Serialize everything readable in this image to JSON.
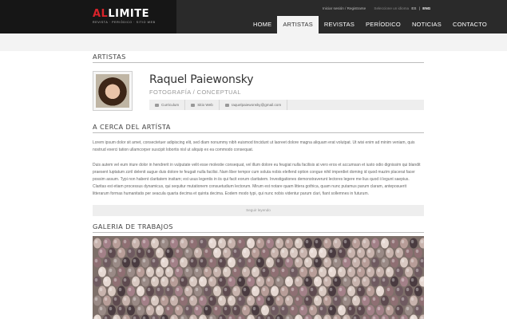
{
  "logo": {
    "brand_prefix": "AL",
    "brand_main": "LIMITE",
    "tagline": "REVISTA · PERIÓDICO · SITIO WEB"
  },
  "top_links": {
    "login": "Iniciar sesión / Registrarse",
    "language_label": "Seleccione un idioma",
    "lang_es": "ES",
    "lang_sep": "|",
    "lang_en": "ENG"
  },
  "nav": {
    "items": [
      "HOME",
      "ARTISTAS",
      "REVISTAS",
      "PERÍODICO",
      "NOTICIAS",
      "CONTACTO"
    ]
  },
  "section": {
    "artists": "ARTISTAS",
    "about": "A CERCA DEL ARTÍSTA",
    "gallery": "GALERIA DE TRABAJOS"
  },
  "artist": {
    "name": "Raquel Paiewonsky",
    "category": "FOTOGRAFÍA / CONCEPTUAL",
    "links": {
      "cv": "Curriculum",
      "website": "Sitio Web",
      "email": "raquelpaiewonsky@gmail.com"
    }
  },
  "about": {
    "p1": "Lorem ipsum dolor sit amet, consectetuer adipiscing elit, sed diam nonummy nibh euismod tincidunt ut laoreet dolore magna aliquam erat volutpat. Ut wisi enim ad minim veniam, quis nostrud exerci tation ullamcorper suscipit lobortis nisl ut aliquip ex ea commodo consequat.",
    "p2": "Duis autem vel eum iriure dolor in hendrerit in vulputate velit esse molestie consequat, vel illum dolore eu feugiat nulla facilisis at vero eros et accumsan et iusto odio dignissim qui blandit praesent luptatum zzril delenit augue duis dolore te feugait nulla facilisi. Nam liber tempor cum soluta nobis eleifend option congue nihil imperdiet doming id quod mazim placerat facer possim assum. Typi non habent claritatem insitam; est usus legentis in iis qui facit eorum claritatem. Investigationes demonstraverunt lectores legere me lius quod ii legunt saepius. Claritas est etiam processus dynamicus, qui sequitur mutationem consuetudium lectorum. Mirum est notare quam littera gothica, quam nunc putamus parum claram, anteposuerit litterarum formas humanitatis per seacula quarta decima et quinta decima. Eodem modo typi, qui nunc nobis videntur parum clari, fiant sollemnes in futurum.",
    "read_more": "Seguir leyendo"
  }
}
